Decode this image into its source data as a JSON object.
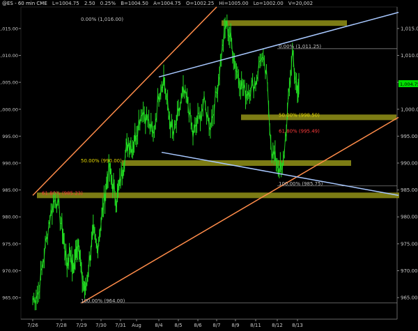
{
  "header": {
    "symbol": "@ES - 60 min  CME",
    "last": "L=1004.75",
    "change": "2.50",
    "change_pct": "0.25%",
    "bid": "B=1004.50",
    "ask": "A=1004.75",
    "open": "O=1002.25",
    "high": "Hi=1005.00",
    "low": "Lo=1002.00",
    "volume": "V=20,002"
  },
  "colors": {
    "background": "#000000",
    "price": "#22dd22",
    "fib_band": "#8a8a16",
    "trend_orange": "#ff8c4a",
    "trend_blue": "#a8c8ff",
    "fib_text_white": "#c0c0c0",
    "fib_text_yellow": "#e6d800",
    "fib_text_red": "#ff3b3b",
    "last_price_box": "#00e000"
  },
  "chart_data": {
    "type": "line",
    "title": "",
    "xlabel": "",
    "ylabel": "",
    "ylim": [
      961,
      1019
    ],
    "y_ticks": [
      "965.00",
      "970.00",
      "975.00",
      "980.00",
      "985.00",
      "990.00",
      "995.00",
      "1,000.00",
      "1,005.00",
      "1,010.00",
      "1,015.00"
    ],
    "x_ticks": [
      "7/26",
      "7/28",
      "7/29",
      "7/30",
      "7/31",
      "Aug",
      "8/4",
      "8/5",
      "8/6",
      "8/7",
      "8/9",
      "8/11",
      "8/12",
      "8/13"
    ],
    "last_price_label": "1,004.75",
    "series": [
      {
        "points": [
          [
            "7/26",
            964.5
          ],
          [
            "7/26",
            966
          ],
          [
            "7/26",
            973
          ],
          [
            "7/26",
            980
          ],
          [
            "7/26",
            984
          ],
          [
            "7/28",
            979
          ],
          [
            "7/28",
            975
          ],
          [
            "7/28",
            971
          ],
          [
            "7/28",
            974
          ],
          [
            "7/28",
            970
          ],
          [
            "7/28",
            973
          ],
          [
            "7/28",
            976
          ],
          [
            "7/29",
            969
          ],
          [
            "7/29",
            966
          ],
          [
            "7/29",
            972
          ],
          [
            "7/29",
            977
          ],
          [
            "7/29",
            974
          ],
          [
            "7/30",
            979
          ],
          [
            "7/30",
            984
          ],
          [
            "7/30",
            989
          ],
          [
            "7/30",
            986
          ],
          [
            "7/30",
            983
          ],
          [
            "7/31",
            987
          ],
          [
            "7/31",
            991
          ],
          [
            "7/31",
            994
          ],
          [
            "7/31",
            993
          ],
          [
            "Aug",
            996
          ],
          [
            "Aug",
            1000
          ],
          [
            "Aug",
            998
          ],
          [
            "Aug",
            995
          ],
          [
            "8/4",
            1003
          ],
          [
            "8/4",
            1006
          ],
          [
            "8/4",
            999
          ],
          [
            "8/4",
            995
          ],
          [
            "8/5",
            999
          ],
          [
            "8/5",
            1003
          ],
          [
            "8/5",
            1001
          ],
          [
            "8/5",
            995
          ],
          [
            "8/6",
            998
          ],
          [
            "8/6",
            1001
          ],
          [
            "8/6",
            997
          ],
          [
            "8/7",
            1003
          ],
          [
            "8/7",
            1010
          ],
          [
            "8/7",
            1016
          ],
          [
            "8/7",
            1013
          ],
          [
            "8/9",
            1008
          ],
          [
            "8/9",
            1005
          ],
          [
            "8/9",
            1003
          ],
          [
            "8/9",
            1004
          ],
          [
            "8/11",
            1005
          ],
          [
            "8/11",
            1010
          ],
          [
            "8/11",
            1006
          ],
          [
            "8/11",
            992
          ],
          [
            "8/12",
            990
          ],
          [
            "8/12",
            988
          ],
          [
            "8/12",
            999
          ],
          [
            "8/12",
            1011
          ],
          [
            "8/13",
            1002
          ],
          [
            "8/13",
            1004.75
          ]
        ]
      }
    ],
    "fib_labels": [
      {
        "text": "0.00% (1,016.00)",
        "level": 1016.0,
        "color": "white"
      },
      {
        "text": "0.00% (1,011.25)",
        "level": 1011.25,
        "color": "white"
      },
      {
        "text": "50.00% (998.50)",
        "level": 998.5,
        "color": "yellow"
      },
      {
        "text": "61.80% (995.49)",
        "level": 995.49,
        "color": "red"
      },
      {
        "text": "50.00% (990.00)",
        "level": 990.0,
        "color": "yellow"
      },
      {
        "text": "100.00% (985.75)",
        "level": 985.75,
        "color": "white"
      },
      {
        "text": "61.80% (985.23)",
        "level": 984.0,
        "color": "red"
      },
      {
        "text": "100.00% (964.00)",
        "level": 964.0,
        "color": "white"
      }
    ],
    "fib_bands": [
      1016.0,
      998.5,
      990.0,
      984.0
    ],
    "trendlines": [
      {
        "color": "orange",
        "from": [
          "7/26",
          984
        ],
        "to": [
          "8/7",
          1019
        ]
      },
      {
        "color": "orange",
        "from": [
          "7/29",
          964
        ],
        "to": [
          "8/13+",
          998.5
        ]
      },
      {
        "color": "blue",
        "from": [
          "8/4",
          1006
        ],
        "to": [
          "8/13+",
          1018
        ]
      },
      {
        "color": "blue",
        "from": [
          "7/31+",
          992
        ],
        "to": [
          "8/13+",
          984
        ]
      }
    ],
    "grid": false
  }
}
